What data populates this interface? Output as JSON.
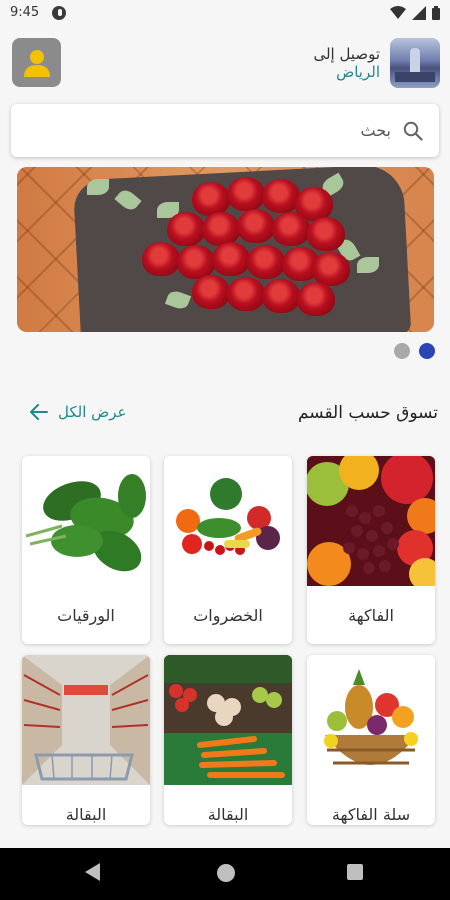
{
  "status_bar": {
    "time": "9:45"
  },
  "header": {
    "location_label": "توصيل إلى",
    "location_city": "الرياض"
  },
  "search": {
    "placeholder": "بحث"
  },
  "carousel": {
    "page_count": 2,
    "active_index": 1
  },
  "section": {
    "title": "تسوق حسب القسم",
    "view_all_label": "عرض الكل"
  },
  "categories": [
    {
      "label": "الفاكهة",
      "image": "fruits"
    },
    {
      "label": "الخضروات",
      "image": "vegetables"
    },
    {
      "label": "الورقيات",
      "image": "leafy-greens"
    },
    {
      "label": "سلة الفاكهة",
      "image": "fruit-basket"
    },
    {
      "label": "البقالة",
      "image": "vegetable-market"
    },
    {
      "label": "البقالة",
      "image": "supermarket-aisle"
    }
  ],
  "colors": {
    "accent": "#1e8a8f",
    "dot_active": "#2b45b5",
    "avatar_icon": "#f2c200"
  }
}
